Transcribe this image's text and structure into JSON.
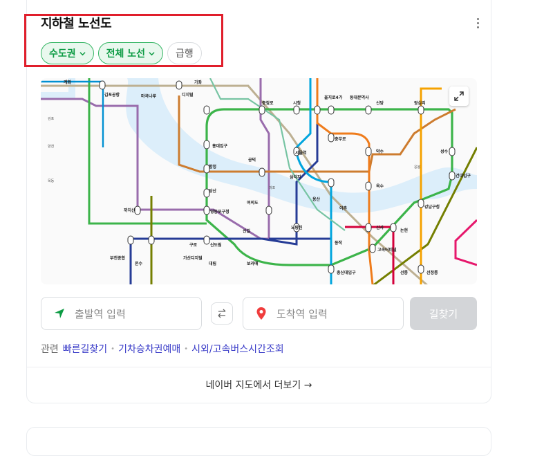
{
  "card": {
    "title": "지하철 노선도",
    "chips": [
      "수도권",
      "전체 노선"
    ],
    "plain_chip": "급행"
  },
  "map": {
    "stations": [
      {
        "name": "계화"
      },
      {
        "name": "김포공항"
      },
      {
        "name": "마곡나루"
      },
      {
        "name": "디지털미디어시티"
      },
      {
        "name": "가좌"
      },
      {
        "name": "신촌"
      },
      {
        "name": "충정로"
      },
      {
        "name": "시청"
      },
      {
        "name": "을지로4가"
      },
      {
        "name": "동대문역사문화공원"
      },
      {
        "name": "신당"
      },
      {
        "name": "왕십리"
      },
      {
        "name": "홍대입구"
      },
      {
        "name": "공덕"
      },
      {
        "name": "서울역"
      },
      {
        "name": "충무로"
      },
      {
        "name": "약수"
      },
      {
        "name": "합정"
      },
      {
        "name": "당산"
      },
      {
        "name": "삼각지"
      },
      {
        "name": "여의도"
      },
      {
        "name": "영등포구청"
      },
      {
        "name": "까치산"
      },
      {
        "name": "신길"
      },
      {
        "name": "노량진"
      },
      {
        "name": "용산"
      },
      {
        "name": "이촌"
      },
      {
        "name": "동작"
      },
      {
        "name": "옥수"
      },
      {
        "name": "성수"
      },
      {
        "name": "건대입구"
      },
      {
        "name": "강남구청"
      },
      {
        "name": "신도림"
      },
      {
        "name": "구로"
      },
      {
        "name": "대림"
      },
      {
        "name": "보라매"
      },
      {
        "name": "고속터미널"
      },
      {
        "name": "신사"
      },
      {
        "name": "논현"
      },
      {
        "name": "온수"
      },
      {
        "name": "부천종합운동장"
      },
      {
        "name": "가산디지털단지"
      },
      {
        "name": "총신대입구"
      },
      {
        "name": "선릉"
      },
      {
        "name": "선정릉"
      }
    ]
  },
  "route": {
    "departure_placeholder": "출발역 입력",
    "arrival_placeholder": "도착역 입력",
    "search_label": "길찾기"
  },
  "related": {
    "label": "관련",
    "links": [
      "빠른길찾기",
      "기차승차권예매",
      "시외/고속버스시간조회"
    ]
  },
  "footer": {
    "more_label": "네이버 지도에서 더보기 →"
  },
  "colors": {
    "line1": "#263c96",
    "line2": "#3cb44a",
    "line3": "#ef7c1c",
    "line4": "#00a5de",
    "line5": "#996cac",
    "line6": "#cd7c2f",
    "line7": "#747f00",
    "line8": "#e6186c",
    "line9": "#bdb092",
    "airport": "#0090d2",
    "shinbundang": "#d4003b",
    "suinbundang": "#f5a200",
    "gyeongui": "#77c4a3",
    "river": "#dceefa",
    "accent_green": "#0c9b43",
    "highlight": "#e01e2b"
  }
}
